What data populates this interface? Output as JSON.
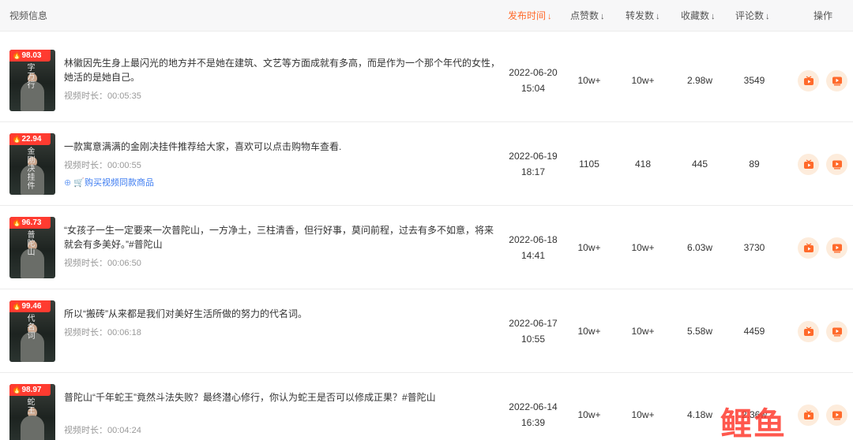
{
  "header": {
    "video_info": "视频信息",
    "publish_time": "发布时间",
    "likes": "点赞数",
    "shares": "转发数",
    "favorites": "收藏数",
    "comments": "评论数",
    "actions": "操作",
    "sort_glyph": "↓",
    "active_color": "#ff6a2b"
  },
  "watermark": "鲤鱼",
  "rows": [
    {
      "badge": "98.03",
      "thumb_text": "字万行",
      "title": "林徽因先生身上最闪光的地方并不是她在建筑、文艺等方面成就有多高，而是作为一个那个年代的女性，她活的是她自己。",
      "duration": "视频时长：00:05:35",
      "date": "2022-06-20",
      "time": "15:04",
      "likes": "10w+",
      "shares": "10w+",
      "favorites": "2.98w",
      "comments": "3549"
    },
    {
      "badge": "22.94",
      "thumb_text": "金刚决挂件",
      "title": "一款寓意满满的金刚决挂件推荐给大家，喜欢可以点击购物车查看.",
      "duration": "视频时长：00:00:55",
      "link": "购买视频同款商品",
      "date": "2022-06-19",
      "time": "18:17",
      "likes": "1105",
      "shares": "418",
      "favorites": "445",
      "comments": "89"
    },
    {
      "badge": "96.73",
      "thumb_text": "普陀山",
      "title": "“女孩子一生一定要来一次普陀山，一方净土，三柱清香，但行好事，莫问前程，过去有多不如意，将来就会有多美好。”#普陀山",
      "duration": "视频时长：00:06:50",
      "date": "2022-06-18",
      "time": "14:41",
      "likes": "10w+",
      "shares": "10w+",
      "favorites": "6.03w",
      "comments": "3730"
    },
    {
      "badge": "99.46",
      "thumb_text": "代名词",
      "title": "所以“搬砖”从来都是我们对美好生活所做的努力的代名词。",
      "duration": "视频时长：00:06:18",
      "date": "2022-06-17",
      "time": "10:55",
      "likes": "10w+",
      "shares": "10w+",
      "favorites": "5.58w",
      "comments": "4459"
    },
    {
      "badge": "98.97",
      "thumb_text": "蛇王",
      "title": "普陀山“千年蛇王”竟然斗法失败？最终潜心修行，你认为蛇王是否可以修成正果？#普陀山",
      "duration": "视频时长：00:04:24",
      "date": "2022-06-14",
      "time": "16:39",
      "likes": "10w+",
      "shares": "10w+",
      "favorites": "4.18w",
      "comments": "2.36w"
    }
  ]
}
